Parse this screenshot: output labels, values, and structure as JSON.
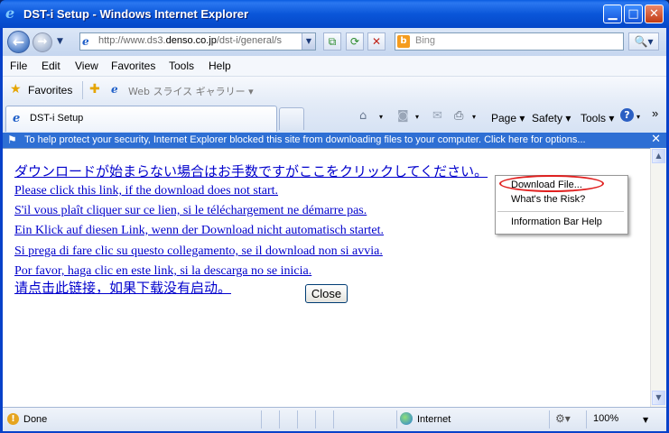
{
  "window": {
    "title": "DST-i Setup - Windows Internet Explorer",
    "minimize_glyph": "▁",
    "maximize_glyph": "□",
    "close_glyph": "✕"
  },
  "nav": {
    "back_glyph": "←",
    "forward_glyph": "→",
    "url_gray_prefix": "http://www.ds3.",
    "url_domain": "denso.co.jp",
    "url_gray_suffix": "/dst-i/general/s",
    "search_placeholder": "Bing",
    "search_go_glyph": "🔍▾"
  },
  "menu": {
    "items": [
      "File",
      "Edit",
      "View",
      "Favorites",
      "Tools",
      "Help"
    ]
  },
  "favorites_bar": {
    "favorites_label": "Favorites",
    "web_slice_label": "Web スライス ギャラリー ▾"
  },
  "tabs": {
    "active_tab_label": "DST-i Setup"
  },
  "command_bar": {
    "page_label": "Page ▾",
    "safety_label": "Safety ▾",
    "tools_label": "Tools ▾",
    "help_glyph": "?",
    "overflow_glyph": "»"
  },
  "info_bar": {
    "message": "To help protect your security, Internet Explorer blocked this site from downloading files to your computer. Click here for options...",
    "close_glyph": "✕"
  },
  "info_bar_menu": {
    "items": [
      "Download File...",
      "What's the Risk?",
      "Information Bar Help"
    ]
  },
  "content": {
    "links": [
      "ダウンロードが始まらない場合はお手数ですがここをクリックしてください。",
      "Please click this link, if the download does not start.",
      "S'il vous plaît cliquer sur ce lien, si le téléchargement ne démarre pas.",
      "Ein Klick auf diesen Link, wenn der Download nicht automatisch startet.",
      "Si prega di fare clic su questo collegamento, se il download non si avvia.",
      "Por favor, haga clic en este link, si la descarga no se inicia.",
      "请点击此链接，如果下载没有启动。"
    ],
    "close_button": "Close"
  },
  "status": {
    "text": "Done",
    "zone": "Internet",
    "zoom": "100%"
  },
  "colors": {
    "title_bar": "#0a56d9",
    "info_bar": "#2e6fd4",
    "link": "#0000cc",
    "highlight_oval": "#e0201f"
  }
}
